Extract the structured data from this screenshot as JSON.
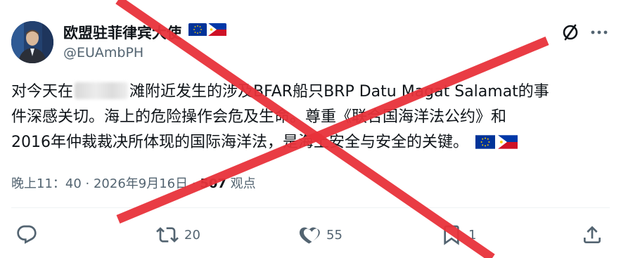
{
  "tweet": {
    "display_name": "欧盟驻菲律宾大使",
    "handle": "@EUAmbPH",
    "text_line_1_a": "对今天在",
    "text_line_1_b": "滩附近发生的涉及BFAR船只BRP Datu Magat Salamat的事",
    "text_line_2": "件深感关切。海上的危险操作会危及生命。尊重《联合国海洋法公约》和",
    "text_line_3": "2016年仲裁裁决所体现的国际海洋法，是海上安全与安全的关键。",
    "timestamp": "晚上11：40 · 2026年9月16日",
    "views_separator": " · ",
    "views_count": "507",
    "views_label": " 观点"
  },
  "actions": {
    "reply_count": "",
    "retweet_count": "20",
    "like_count": "55",
    "bookmark_count": "1"
  },
  "icons": {
    "grok": "grok-icon",
    "more": "more-icon",
    "reply": "reply-icon",
    "retweet": "retweet-icon",
    "like": "heart-icon",
    "bookmark": "bookmark-icon",
    "share": "share-icon",
    "flags": [
      "eu-flag-icon",
      "philippines-flag-icon"
    ]
  },
  "colors": {
    "text_primary": "#0f1419",
    "text_secondary": "#536471",
    "cross_overlay": "#e8323a",
    "eu_blue": "#003399",
    "eu_star": "#ffcc00"
  }
}
